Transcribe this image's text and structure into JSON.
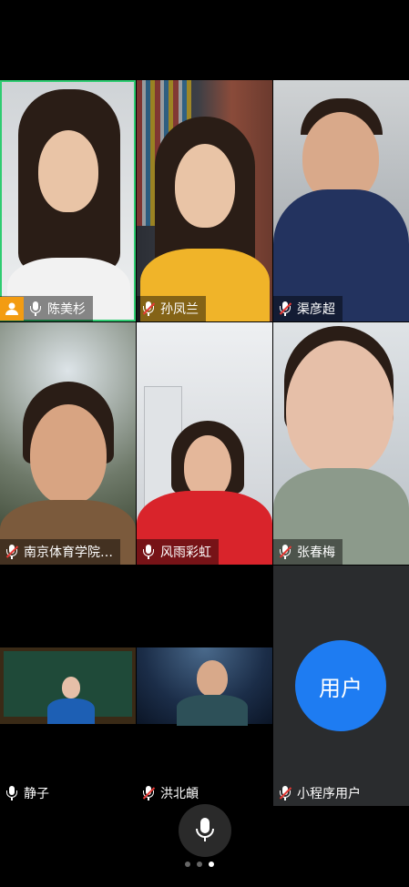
{
  "participants": [
    {
      "name": "陈美杉"
    },
    {
      "name": "孙凤兰"
    },
    {
      "name": "渠彦超"
    },
    {
      "name": "南京体育学院…"
    },
    {
      "name": "风雨彩虹"
    },
    {
      "name": "张春梅"
    },
    {
      "name": "静子"
    },
    {
      "name": "洪北頔"
    },
    {
      "name": "小程序用户",
      "avatar_text": "用户"
    }
  ],
  "colors": {
    "active_speaker_border": "#2ecc71",
    "mute_red": "#e53935",
    "avatar_blue": "#1e7cf2",
    "host_badge": "#f39c12"
  },
  "pager": {
    "pages": 3,
    "current": 3
  }
}
